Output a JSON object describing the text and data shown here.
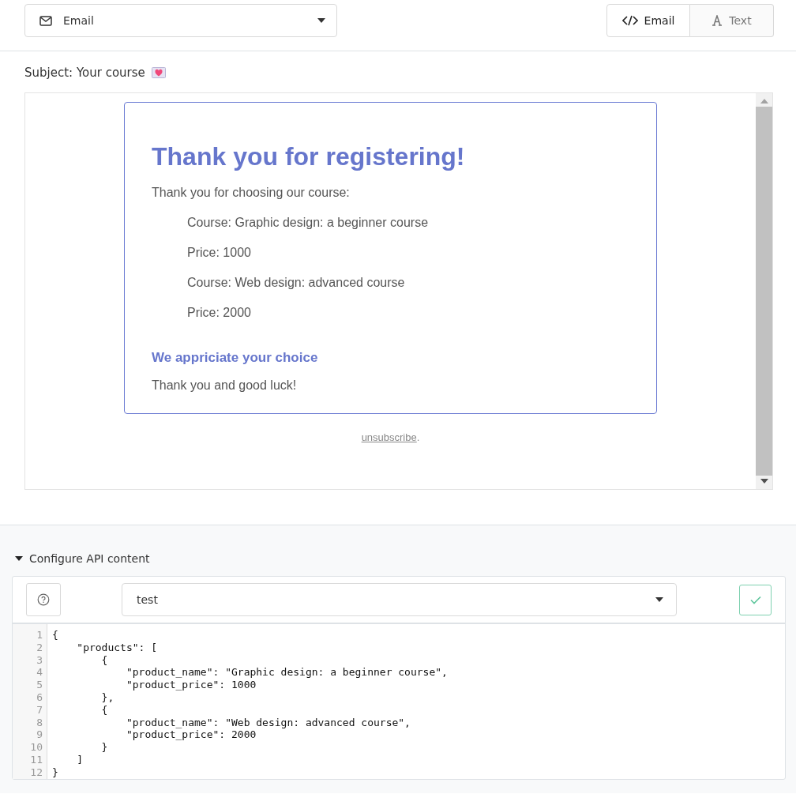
{
  "format_select": {
    "value": "Email"
  },
  "view_toggle": [
    {
      "label": "Email",
      "kind": "code",
      "selected": true
    },
    {
      "label": "Text",
      "kind": "text",
      "selected": false
    }
  ],
  "subject": {
    "text": "Subject: Your course"
  },
  "email": {
    "heading": "Thank you for registering!",
    "intro": "Thank you for choosing our course:",
    "items": [
      "Course: Graphic design: a beginner course",
      "Price: 1000",
      "Course: Web design: advanced course",
      "Price: 2000"
    ],
    "subheading": "We appriciate your choice",
    "closing": "Thank you and good luck!",
    "footer": {
      "link": "unsubscribe",
      "after": "."
    }
  },
  "api_section": {
    "title": "Configure API content",
    "expanded": true,
    "select_value": "test",
    "code_lines": [
      {
        "number": "1",
        "text": "{"
      },
      {
        "number": "2",
        "text": "    \"products\": ["
      },
      {
        "number": "3",
        "text": "        {"
      },
      {
        "number": "4",
        "text": "            \"product_name\": \"Graphic design: a beginner course\","
      },
      {
        "number": "5",
        "text": "            \"product_price\": 1000"
      },
      {
        "number": "6",
        "text": "        },"
      },
      {
        "number": "7",
        "text": "        {"
      },
      {
        "number": "8",
        "text": "            \"product_name\": \"Web design: advanced course\","
      },
      {
        "number": "9",
        "text": "            \"product_price\": 2000"
      },
      {
        "number": "10",
        "text": "        }"
      },
      {
        "number": "11",
        "text": "    ]"
      },
      {
        "number": "12",
        "text": "}"
      }
    ]
  }
}
